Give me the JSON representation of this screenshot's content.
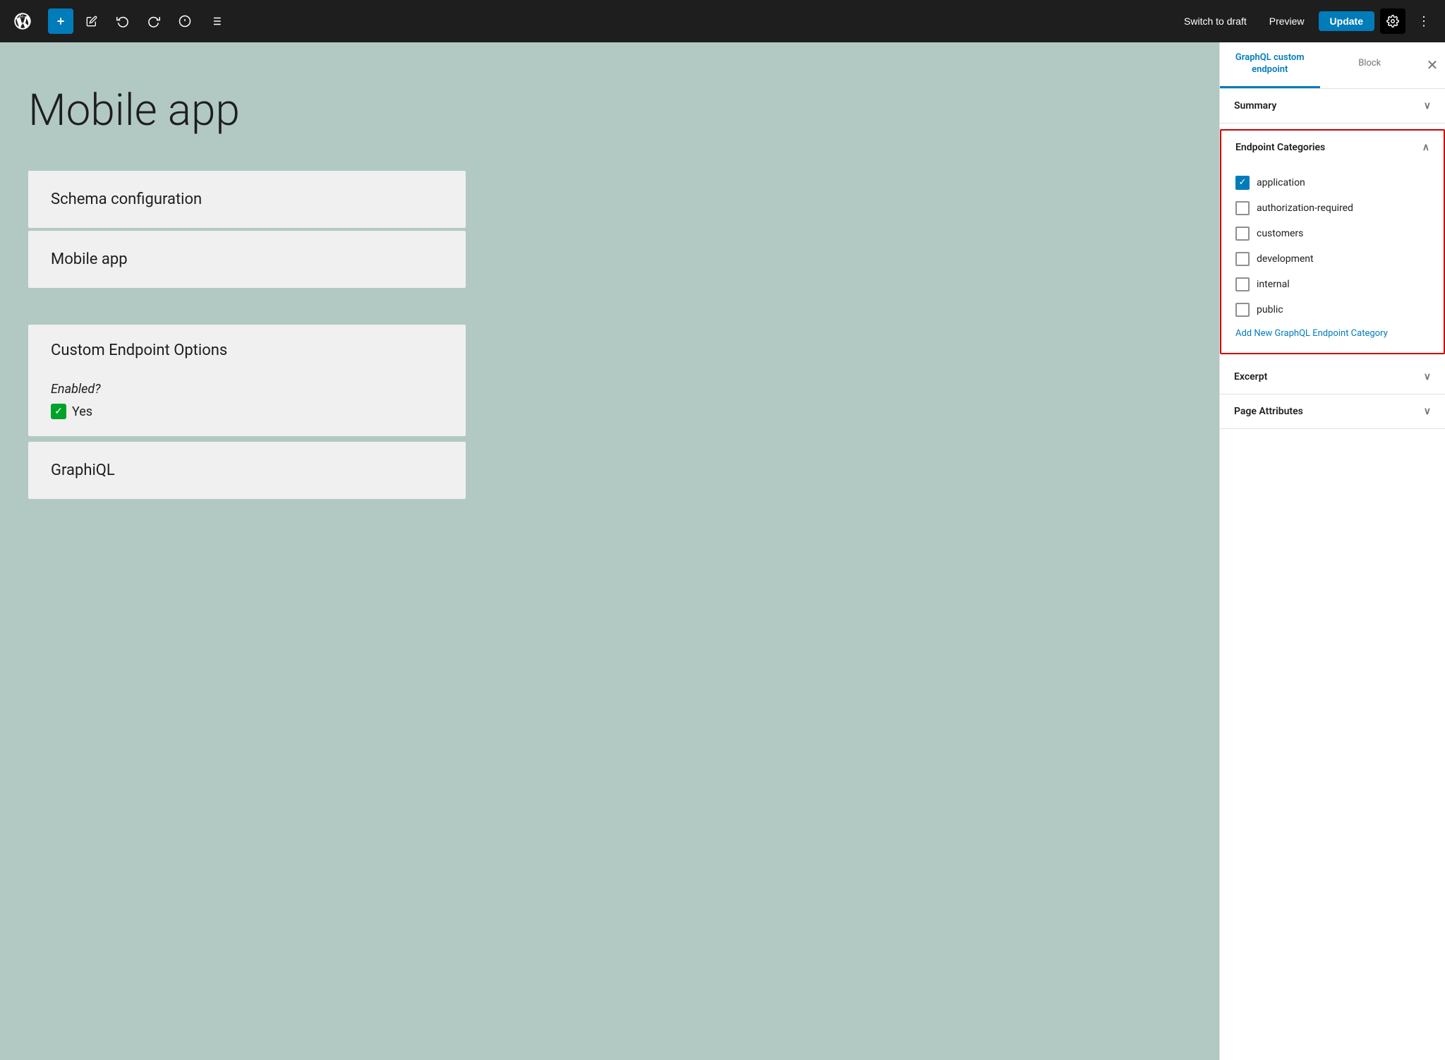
{
  "toolbar": {
    "add_label": "+",
    "switch_draft_label": "Switch to draft",
    "preview_label": "Preview",
    "update_label": "Update"
  },
  "editor": {
    "page_title": "Mobile app",
    "blocks": [
      {
        "label": "Schema configuration"
      },
      {
        "label": "Mobile app"
      }
    ],
    "custom_endpoint_section": {
      "header": "Custom Endpoint Options",
      "enabled_label": "Enabled?",
      "enabled_value": "Yes"
    },
    "graphiql_section": {
      "header": "GraphiQL"
    }
  },
  "sidebar": {
    "tab1_label": "GraphQL custom endpoint",
    "tab2_label": "Block",
    "summary_label": "Summary",
    "endpoint_categories_label": "Endpoint Categories",
    "categories": [
      {
        "name": "application",
        "checked": true
      },
      {
        "name": "authorization-required",
        "checked": false
      },
      {
        "name": "customers",
        "checked": false
      },
      {
        "name": "development",
        "checked": false
      },
      {
        "name": "internal",
        "checked": false
      },
      {
        "name": "public",
        "checked": false
      }
    ],
    "add_category_link": "Add New GraphQL Endpoint Category",
    "excerpt_label": "Excerpt",
    "page_attributes_label": "Page Attributes"
  }
}
